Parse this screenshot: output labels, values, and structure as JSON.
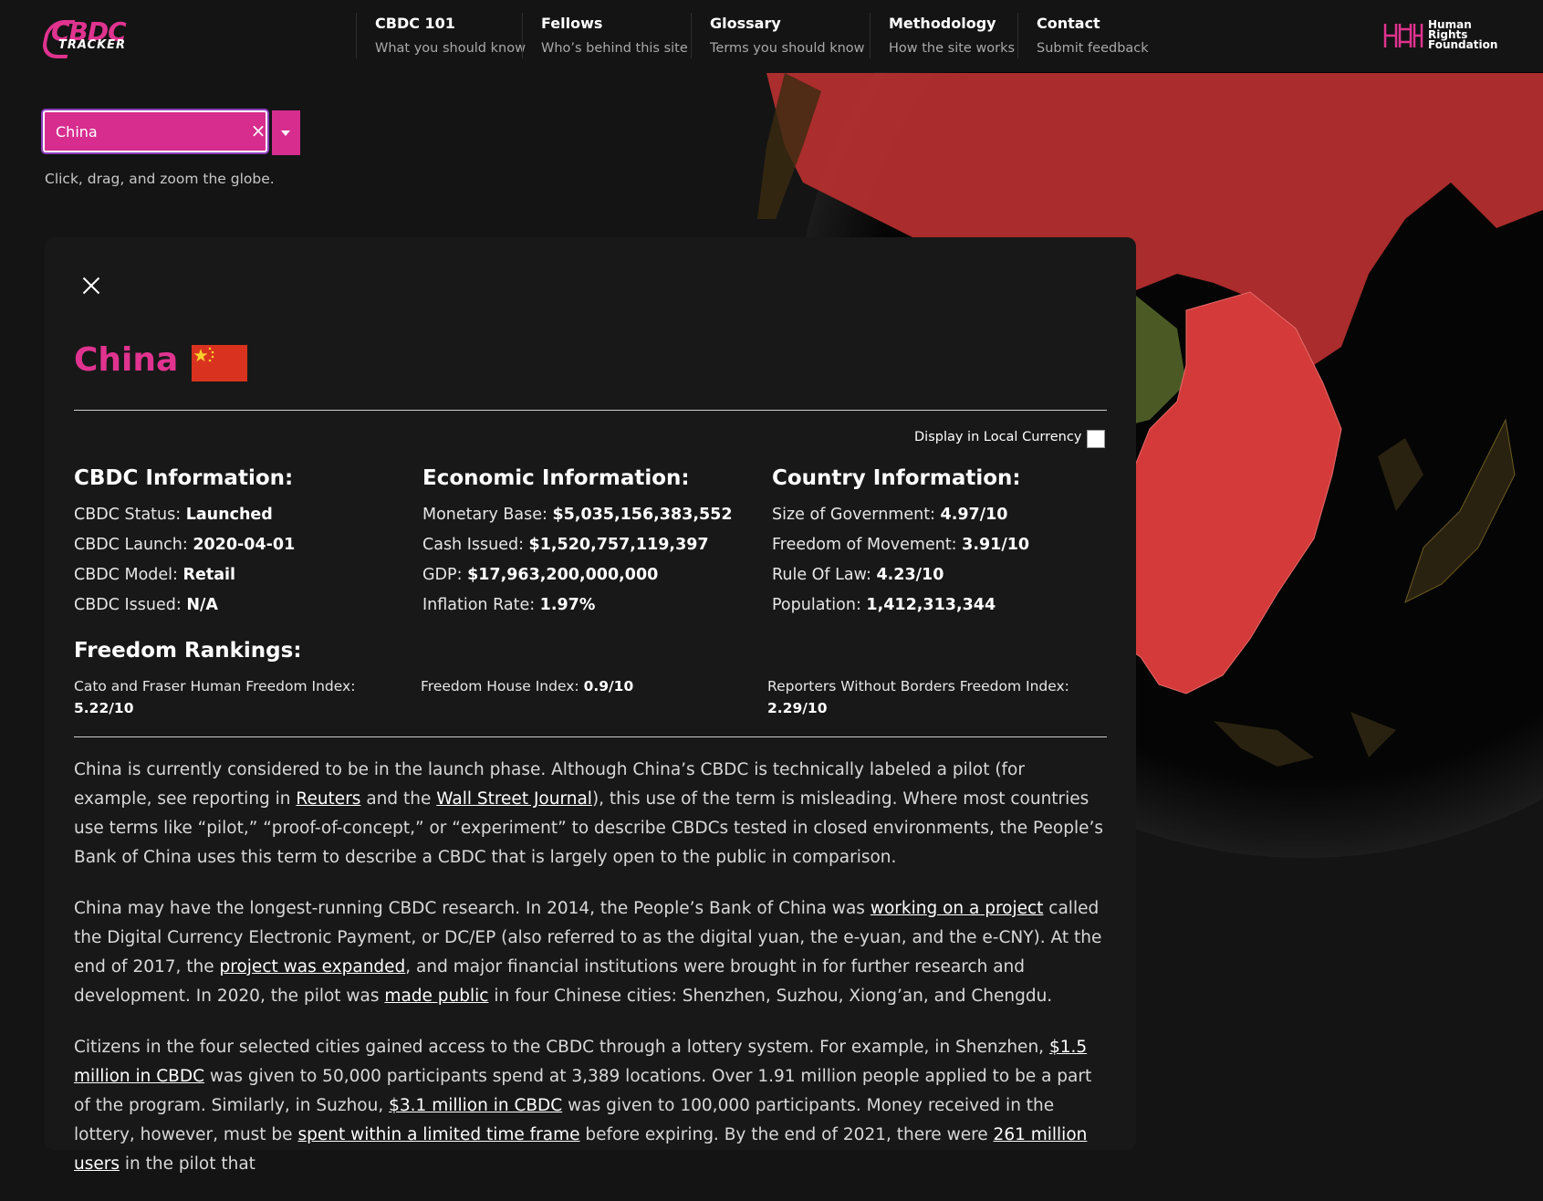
{
  "header": {
    "logo_line1": "CBDC",
    "logo_line2": "TRACKER",
    "partner_logo": [
      "Human",
      "Rights",
      "Foundation"
    ],
    "nav": [
      {
        "title": "CBDC 101",
        "subtitle": "What you should know"
      },
      {
        "title": "Fellows",
        "subtitle": "Who’s behind this site"
      },
      {
        "title": "Glossary",
        "subtitle": "Terms you should know"
      },
      {
        "title": "Methodology",
        "subtitle": "How the site works"
      },
      {
        "title": "Contact",
        "subtitle": "Submit feedback"
      }
    ]
  },
  "search": {
    "value": "China",
    "clear_glyph": "×",
    "hint": "Click, drag, and zoom the globe."
  },
  "panel": {
    "country": "China",
    "local_currency_label": "Display in Local Currency",
    "local_currency_checked": false,
    "cbdc": {
      "heading": "CBDC Information:",
      "rows": [
        {
          "label": "CBDC Status: ",
          "value": "Launched"
        },
        {
          "label": "CBDC Launch: ",
          "value": "2020-04-01"
        },
        {
          "label": "CBDC Model: ",
          "value": "Retail"
        },
        {
          "label": "CBDC Issued: ",
          "value": "N/A"
        }
      ]
    },
    "economic": {
      "heading": "Economic Information:",
      "rows": [
        {
          "label": "Monetary Base: ",
          "value": "$5,035,156,383,552"
        },
        {
          "label": "Cash Issued: ",
          "value": "$1,520,757,119,397"
        },
        {
          "label": "GDP: ",
          "value": "$17,963,200,000,000"
        },
        {
          "label": "Inflation Rate: ",
          "value": "1.97%"
        }
      ]
    },
    "country_info": {
      "heading": "Country Information:",
      "rows": [
        {
          "label": "Size of Government: ",
          "value": "4.97/10"
        },
        {
          "label": "Freedom of Movement: ",
          "value": "3.91/10"
        },
        {
          "label": "Rule Of Law: ",
          "value": "4.23/10"
        },
        {
          "label": "Population: ",
          "value": "1,412,313,344"
        }
      ]
    },
    "freedom": {
      "heading": "Freedom Rankings:",
      "items": [
        {
          "label": "Cato and Fraser Human Freedom Index: ",
          "value": "5.22/10"
        },
        {
          "label": "Freedom House Index: ",
          "value": "0.9/10"
        },
        {
          "label": "Reporters Without Borders Freedom Index: ",
          "value": "2.29/10"
        }
      ]
    },
    "paragraphs": [
      [
        {
          "t": "China is currently considered to be in the launch phase. Although China’s CBDC is technically labeled a pilot (for example, see reporting in "
        },
        {
          "t": "Reuters",
          "link": true
        },
        {
          "t": " and the "
        },
        {
          "t": "Wall Street Journal",
          "link": true
        },
        {
          "t": "), this use of the term is misleading. Where most countries use terms like “pilot,” “proof-of-concept,” or “experiment” to describe CBDCs tested in closed environments, the People’s Bank of China uses this term to describe a CBDC that is largely open to the public in comparison."
        }
      ],
      [
        {
          "t": "China may have the longest-running CBDC research. In 2014, the People’s Bank of China was "
        },
        {
          "t": "working on a project",
          "link": true
        },
        {
          "t": " called the Digital Currency Electronic Payment, or DC/EP (also referred to as the digital yuan, the e-yuan, and the e-CNY). At the end of 2017, the "
        },
        {
          "t": "project was expanded",
          "link": true
        },
        {
          "t": ", and major financial institutions were brought in for further research and development. In 2020, the pilot was "
        },
        {
          "t": "made public",
          "link": true
        },
        {
          "t": " in four Chinese cities: Shenzhen, Suzhou, Xiong’an, and Chengdu."
        }
      ],
      [
        {
          "t": "Citizens in the four selected cities gained access to the CBDC through a lottery system. For example, in Shenzhen, "
        },
        {
          "t": "$1.5 million in CBDC",
          "link": true
        },
        {
          "t": " was given to 50,000 participants spend at 3,389 locations. Over 1.91 million people applied to be a part of the program. Similarly, in Suzhou, "
        },
        {
          "t": "$3.1 million in CBDC",
          "link": true
        },
        {
          "t": " was given to 100,000 participants. Money received in the lottery, however, must be "
        },
        {
          "t": "spent within a limited time frame",
          "link": true
        },
        {
          "t": " before expiring. By the end of 2021, there were "
        },
        {
          "t": "261 million users",
          "link": true
        },
        {
          "t": " in the pilot that"
        }
      ]
    ]
  },
  "colors": {
    "accent": "#e0338f",
    "search_bg": "#d72d8f",
    "globe_red": "#d43a3a",
    "background": "#141414",
    "panel": "#181818"
  }
}
